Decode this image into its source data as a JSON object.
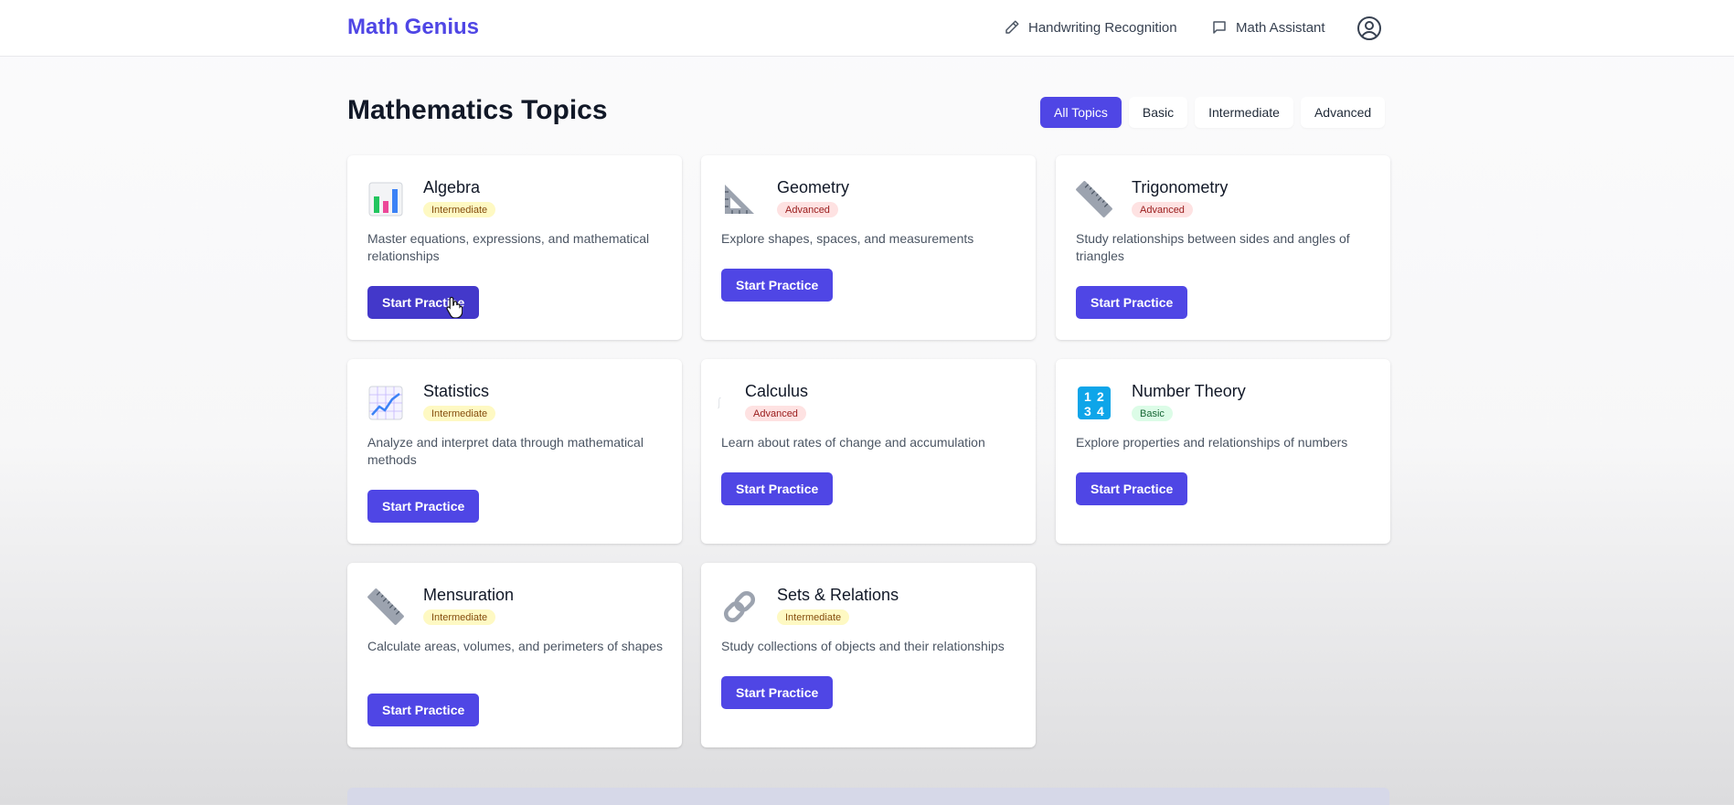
{
  "header": {
    "brand": "Math Genius",
    "nav": [
      {
        "label": "Handwriting Recognition",
        "icon": "pencil-icon"
      },
      {
        "label": "Math Assistant",
        "icon": "chat-bubble-icon"
      }
    ],
    "user_icon": "user-circle-icon"
  },
  "main": {
    "title": "Mathematics Topics",
    "filters": [
      "All Topics",
      "Basic",
      "Intermediate",
      "Advanced"
    ],
    "active_filter": "All Topics"
  },
  "topics": [
    {
      "name": "Algebra",
      "level": "Intermediate",
      "description": "Master equations, expressions, and mathematical relationships",
      "button": "Start Practice",
      "icon": "bar-chart-icon"
    },
    {
      "name": "Geometry",
      "level": "Advanced",
      "description": "Explore shapes, spaces, and measurements",
      "button": "Start Practice",
      "icon": "triangle-ruler-icon"
    },
    {
      "name": "Trigonometry",
      "level": "Advanced",
      "description": "Study relationships between sides and angles of triangles",
      "button": "Start Practice",
      "icon": "ruler-icon"
    },
    {
      "name": "Statistics",
      "level": "Intermediate",
      "description": "Analyze and interpret data through mathematical methods",
      "button": "Start Practice",
      "icon": "line-chart-icon"
    },
    {
      "name": "Calculus",
      "level": "Advanced",
      "description": "Learn about rates of change and accumulation",
      "button": "Start Practice",
      "icon": "integral-icon"
    },
    {
      "name": "Number Theory",
      "level": "Basic",
      "description": "Explore properties and relationships of numbers",
      "button": "Start Practice",
      "icon": "numbers-1234-icon"
    },
    {
      "name": "Mensuration",
      "level": "Intermediate",
      "description": "Calculate areas, volumes, and perimeters of shapes",
      "button": "Start Practice",
      "icon": "ruler-icon"
    },
    {
      "name": "Sets & Relations",
      "level": "Intermediate",
      "description": "Study collections of objects and their relationships",
      "button": "Start Practice",
      "icon": "link-icon"
    }
  ],
  "colors": {
    "accent": "#4f46e5",
    "intermediate_badge": "#fef9c3",
    "advanced_badge": "#fee2e2",
    "basic_badge": "#dcfce7"
  }
}
